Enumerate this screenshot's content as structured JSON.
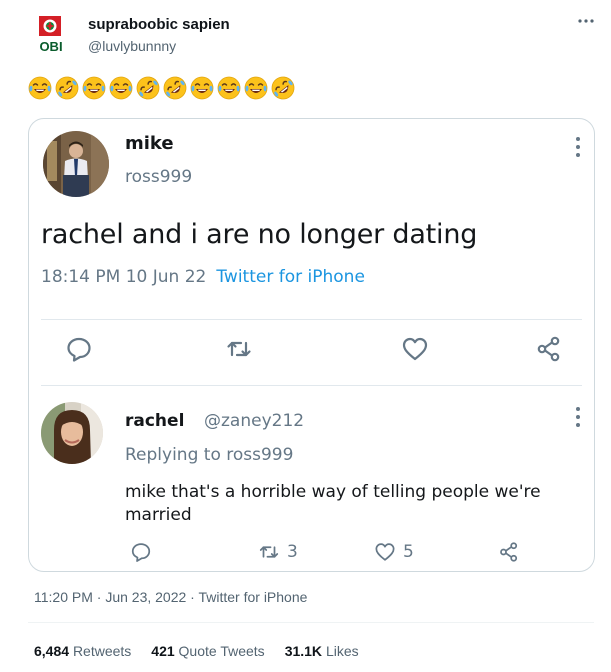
{
  "author": {
    "logo_text": "OBI",
    "name": "supraboobic sapien",
    "handle": "@luvlybunnny"
  },
  "emojis": [
    "joy",
    "rofl",
    "joy",
    "joy",
    "rofl",
    "rofl",
    "joy",
    "joy",
    "joy",
    "rofl"
  ],
  "quoted_tweet": {
    "name": "mike",
    "handle": "ross999",
    "text": "rachel and i are no longer dating",
    "time": "18:14 PM  10 Jun 22",
    "source": "Twitter for iPhone"
  },
  "reply": {
    "name": "rachel",
    "handle": "@zaney212",
    "replying_to": "Replying to ross999",
    "text": "mike that's a horrible way of telling people we're married",
    "retweets": "3",
    "likes": "5"
  },
  "timestamp": "11:20 PM · Jun 23, 2022 · Twitter for iPhone",
  "stats": {
    "retweets_count": "6,484",
    "retweets_label": "Retweets",
    "quotes_count": "421",
    "quotes_label": "Quote Tweets",
    "likes_count": "31.1K",
    "likes_label": "Likes"
  },
  "colors": {
    "accent": "#1b95e0",
    "muted": "#536471",
    "border": "#cfd9de",
    "logo_red": "#d41f26",
    "logo_green": "#0a8a3a"
  }
}
